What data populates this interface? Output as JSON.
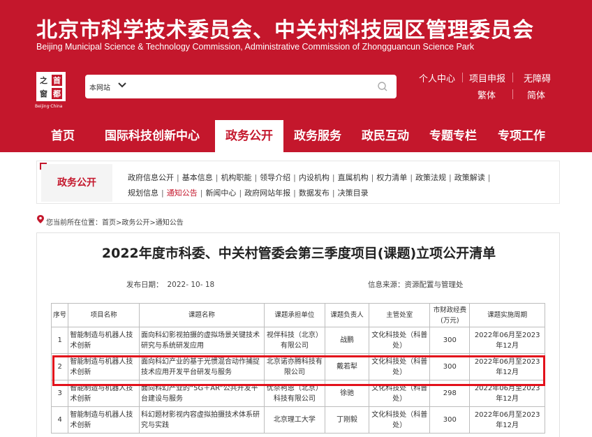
{
  "header": {
    "title_cn": "北京市科学技术委员会、中关村科技园区管理委员会",
    "title_en": "Beijing Municipal Science & Technology Commission, Administrative Commission of Zhongguancun Science Park",
    "logo": {
      "chars": [
        "之",
        "首",
        "窗",
        "都"
      ],
      "sub": "Beijing·China"
    },
    "search": {
      "scope": "本网站",
      "placeholder": ""
    },
    "toplinks": [
      "个人中心",
      "项目申报",
      "无障碍",
      "繁体",
      "简体"
    ]
  },
  "nav": {
    "items": [
      "首页",
      "国际科技创新中心",
      "政务公开",
      "政务服务",
      "政民互动",
      "专题专栏",
      "专项工作"
    ],
    "active": "政务公开"
  },
  "subnav": {
    "title": "政务公开",
    "links": [
      "政府信息公开",
      "基本信息",
      "机构职能",
      "领导介绍",
      "内设机构",
      "直属机构",
      "权力清单",
      "政策法规",
      "政策解读",
      "规划信息",
      "通知公告",
      "新闻中心",
      "政府网站年报",
      "数据发布",
      "决策目录"
    ],
    "active": "通知公告"
  },
  "breadcrumb": "您当前所在位置：首页>政务公开>通知公告",
  "doc": {
    "title": "2022年度市科委、中关村管委会第三季度项目(课题)立项公开清单",
    "date_label": "发布日期：",
    "date": "2022- 10- 18",
    "source_label": "信息来源：",
    "source": "资源配置与管理处"
  },
  "table": {
    "headers": [
      "序号",
      "项目名称",
      "课题名称",
      "课题承担单位",
      "课题负责人",
      "主管处室",
      "市财政经费(万元)",
      "课题实施周期"
    ],
    "rows": [
      [
        "1",
        "智能制造与机器人技术创新",
        "面向科幻影视拍摄的虚拟场景关键技术研究与系统研发应用",
        "视伴科技（北京）有限公司",
        "战鹏",
        "文化科技处（科普处）",
        "300",
        "2022年06月至2023年12月"
      ],
      [
        "2",
        "智能制造与机器人技术创新",
        "面向科幻产业的基于光惯混合动作捕捉技术应用开发平台研发与服务",
        "北京诺亦腾科技有限公司",
        "戴若犁",
        "文化科技处（科普处）",
        "300",
        "2022年06月至2023年12月"
      ],
      [
        "3",
        "智能制造与机器人技术创新",
        "面向科幻产业的“5G＋AR”公共开发平台建设与服务",
        "优奈柯恩（北京）科技有限公司",
        "徐驰",
        "文化科技处（科普处）",
        "298",
        "2022年06月至2023年12月"
      ],
      [
        "4",
        "智能制造与机器人技术创新",
        "科幻题材影视内容虚拟拍摄技术体系研究与实践",
        "北京理工大学",
        "丁刚毅",
        "文化科技处（科普处）",
        "300",
        "2022年06月至2023年12月"
      ]
    ]
  },
  "colors": {
    "brand": "#c4172c",
    "highlight": "#e3111b"
  }
}
